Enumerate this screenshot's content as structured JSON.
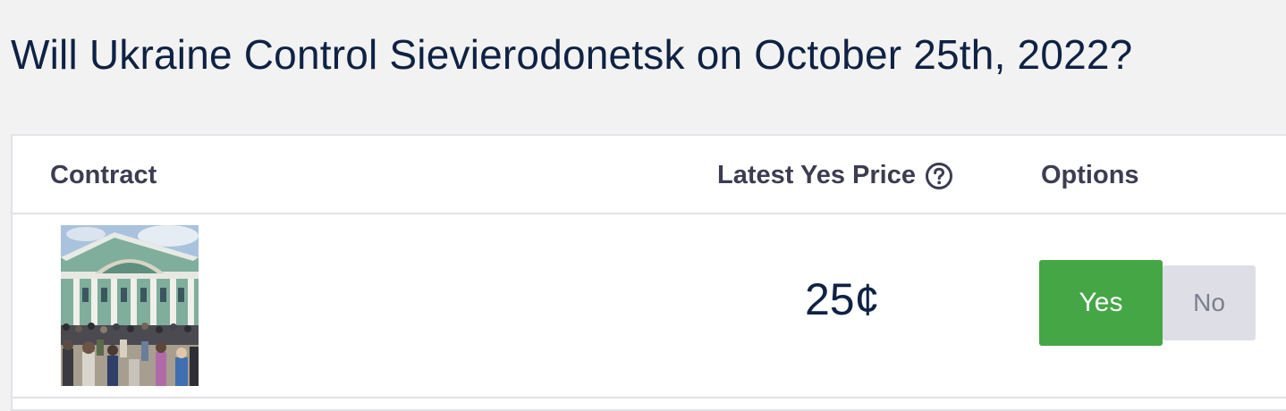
{
  "market": {
    "title": "Will Ukraine Control Sievierodonetsk on October 25th, 2022?"
  },
  "table": {
    "headers": {
      "contract": "Contract",
      "latest_price": "Latest Yes Price",
      "options": "Options"
    },
    "rows": [
      {
        "image_icon": "building-crowd-photo",
        "price": "25¢",
        "yes_label": "Yes",
        "no_label": "No"
      }
    ]
  },
  "colors": {
    "title": "#0e2244",
    "yes_button": "#45a646",
    "no_button": "#dedfe6",
    "background": "#f2f2f2"
  }
}
